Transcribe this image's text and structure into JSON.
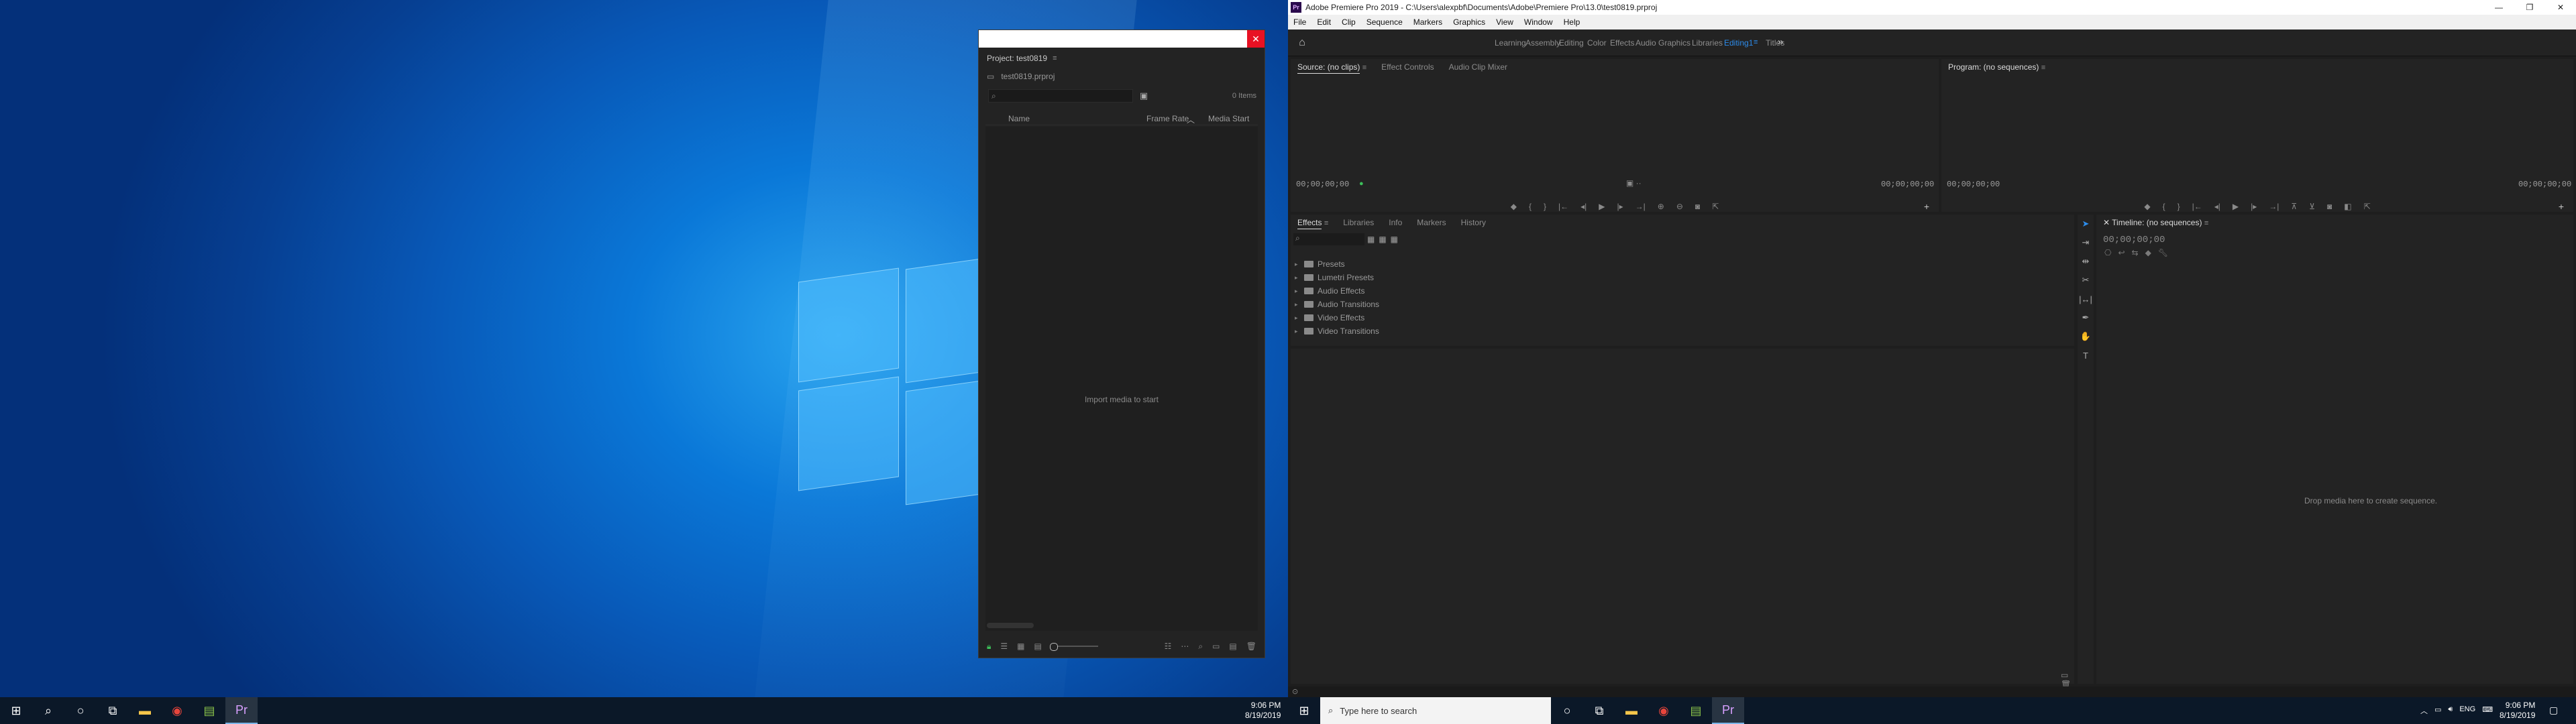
{
  "left_screen": {
    "project_window": {
      "panel_tab": "Project: test0819",
      "file": "test0819.prproj",
      "search_placeholder": "",
      "item_count": "0 Items",
      "columns": [
        "Name",
        "Frame Rate",
        "Media Start"
      ],
      "empty_message": "Import media to start",
      "close_label": "✕"
    },
    "taskbar": {
      "time": "9:06 PM",
      "date": "8/19/2019"
    }
  },
  "premiere": {
    "title": "Adobe Premiere Pro 2019 - C:\\Users\\alexpbf\\Documents\\Adobe\\Premiere Pro\\13.0\\test0819.prproj",
    "icon_text": "Pr",
    "window_controls": [
      "—",
      "❐",
      "✕"
    ],
    "menu": [
      "File",
      "Edit",
      "Clip",
      "Sequence",
      "Markers",
      "Graphics",
      "View",
      "Window",
      "Help"
    ],
    "workspaces": [
      "Learning",
      "Assembly",
      "Editing",
      "Color",
      "Effects",
      "Audio",
      "Graphics",
      "Libraries",
      "Editing1",
      "Titles"
    ],
    "active_workspace": "Editing1",
    "more_label": "»",
    "source_panel": {
      "tabs": [
        "Source: (no clips)",
        "Effect Controls",
        "Audio Clip Mixer"
      ],
      "timecode_left": "00;00;00;00",
      "timecode_right": "00;00;00;00"
    },
    "program_panel": {
      "tab": "Program: (no sequences)",
      "timecode_left": "00;00;00;00",
      "timecode_right": "00;00;00;00"
    },
    "effects_panel": {
      "tabs": [
        "Effects",
        "Libraries",
        "Info",
        "Markers",
        "History"
      ],
      "items": [
        "Presets",
        "Lumetri Presets",
        "Audio Effects",
        "Audio Transitions",
        "Video Effects",
        "Video Transitions"
      ]
    },
    "timeline_panel": {
      "tab": "Timeline: (no sequences)",
      "timecode": "00;00;00;00",
      "drop_message": "Drop media here to create sequence."
    }
  },
  "right_taskbar": {
    "search_placeholder": "Type here to search",
    "language": "ENG",
    "time": "9:06 PM",
    "date": "8/19/2019"
  }
}
